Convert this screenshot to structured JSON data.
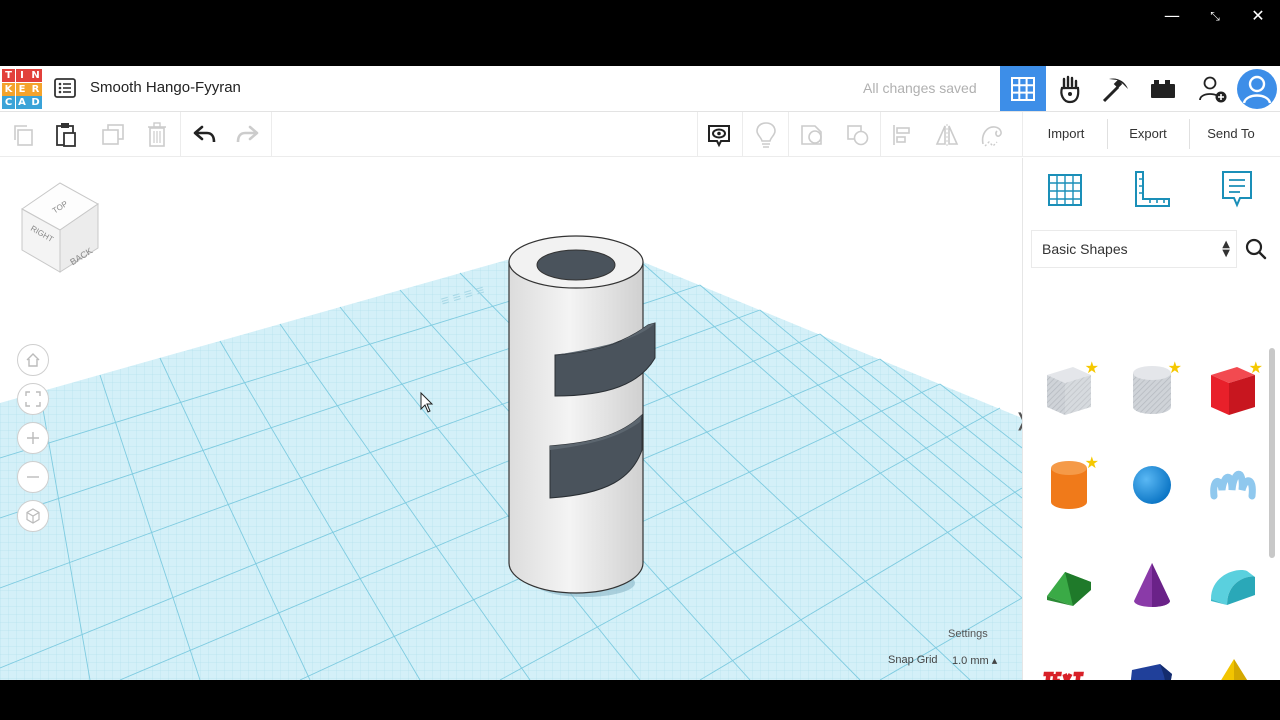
{
  "window": {
    "minimize_glyph": "—",
    "restore_glyph": "⤡",
    "close_glyph": "✕"
  },
  "header": {
    "logo_letters": [
      "T",
      "I",
      "N",
      "K",
      "E",
      "R",
      "C",
      "A",
      "D"
    ],
    "logo_colors": [
      "#e2403b",
      "#e2403b",
      "#e2403b",
      "#f4a32b",
      "#f4a32b",
      "#f4a32b",
      "#3aa3d8",
      "#3aa3d8",
      "#3aa3d8"
    ],
    "project_title": "Smooth Hango-Fyyran",
    "save_status": "All changes saved",
    "accent_color": "#3d8ee8",
    "buttons": [
      "3d-design-grid-icon",
      "circuits-hand-icon",
      "minecraft-pickaxe-icon",
      "lego-brick-icon",
      "add-user-icon",
      "user-avatar-icon"
    ]
  },
  "toolbar": {
    "tools": [
      "copy-icon",
      "paste-icon",
      "duplicate-icon",
      "delete-icon",
      "undo-icon",
      "redo-icon"
    ],
    "view_tools": [
      "notes-toggle-icon",
      "light-bulb-icon",
      "group-icon",
      "ungroup-icon",
      "align-icon",
      "mirror-icon",
      "workplane-lock-icon"
    ],
    "import_label": "Import",
    "export_label": "Export",
    "send_label": "Send To"
  },
  "viewcube": {
    "top_label": "TOP",
    "right_label": "RIGHT",
    "back_label": "BACK"
  },
  "viewport": {
    "settings_label": "Settings",
    "snap_grid_label": "Snap Grid",
    "snap_grid_value": "1.0 mm ▴",
    "collapse_glyph": "❭",
    "grid_color": "#bfe8f4"
  },
  "shapes_panel": {
    "top_icons": [
      "workplane-grid-icon",
      "ruler-icon",
      "notes-icon"
    ],
    "category": "Basic Shapes",
    "shapes": [
      {
        "name": "box-hole",
        "color": "#c8ccd2",
        "starred": true
      },
      {
        "name": "cylinder-hole",
        "color": "#c8ccd2",
        "starred": true
      },
      {
        "name": "box",
        "color": "#e8202a",
        "starred": true
      },
      {
        "name": "cylinder",
        "color": "#f07a1a",
        "starred": true
      },
      {
        "name": "sphere",
        "color": "#1a8fe0",
        "starred": false
      },
      {
        "name": "scribble",
        "color": "#8fc8ee",
        "starred": false
      },
      {
        "name": "roof",
        "color": "#2e9a3a",
        "starred": false
      },
      {
        "name": "cone",
        "color": "#8a3aa8",
        "starred": false
      },
      {
        "name": "round-roof",
        "color": "#3ab8c8",
        "starred": false
      },
      {
        "name": "text",
        "color": "#d82028",
        "starred": false
      },
      {
        "name": "polygon",
        "color": "#20409a",
        "starred": false
      },
      {
        "name": "pyramid",
        "color": "#f2c400",
        "starred": false
      }
    ],
    "star_glyph": "★"
  }
}
